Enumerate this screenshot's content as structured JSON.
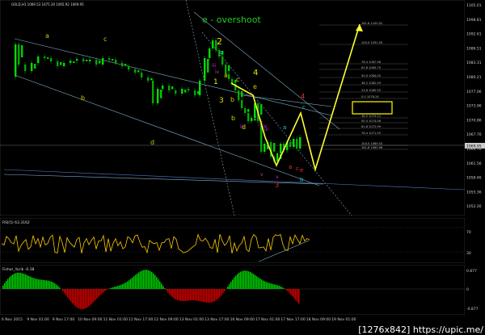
{
  "main": {
    "header": "GOLD,H1  1069.53 1075.30 1065.92 1069.95",
    "overshoot_label": "e - overshoot",
    "wave_labels": [
      {
        "text": "a",
        "color": "#cccc00"
      },
      {
        "text": "b",
        "color": "#cccc00"
      },
      {
        "text": "c",
        "color": "#cccc00"
      },
      {
        "text": "d",
        "color": "#cccc00"
      },
      {
        "text": "2",
        "color": "#e6e600"
      },
      {
        "text": "c",
        "color": "#22ccdd"
      },
      {
        "text": "iii",
        "color": "#cc33cc"
      },
      {
        "text": "iv",
        "color": "#cc33cc"
      },
      {
        "text": "1",
        "color": "#e6e600"
      },
      {
        "text": "a",
        "color": "#cccc00"
      },
      {
        "text": "b",
        "color": "#cccc00"
      },
      {
        "text": "c",
        "color": "#cccc00"
      },
      {
        "text": "4",
        "color": "#e6e600"
      },
      {
        "text": "e",
        "color": "#cccc00"
      },
      {
        "text": "3",
        "color": "#e6e600"
      },
      {
        "text": "b",
        "color": "#cccc00"
      },
      {
        "text": "d",
        "color": "#cccc00"
      },
      {
        "text": "i",
        "color": "#cc33cc"
      },
      {
        "text": "ii",
        "color": "#cc33cc"
      },
      {
        "text": "iv",
        "color": "#cc33cc"
      },
      {
        "text": "v",
        "color": "#cc33cc"
      },
      {
        "text": "iii",
        "color": "#cc33cc"
      },
      {
        "text": "iii",
        "color": "#cc33cc"
      },
      {
        "text": "v",
        "color": "#cc33cc"
      },
      {
        "text": "3",
        "color": "#ee3333"
      },
      {
        "text": "a",
        "color": "#22ccdd"
      },
      {
        "text": "c",
        "color": "#22ccdd"
      },
      {
        "text": "4",
        "color": "#ee3333"
      },
      {
        "text": "a",
        "color": "#ee3333"
      },
      {
        "text": "c",
        "color": "#ee3333"
      },
      {
        "text": "e",
        "color": "#ee3333"
      },
      {
        "text": "b",
        "color": "#22ccdd"
      }
    ],
    "fib_labels": [
      "161.8  1100.02",
      "100.0  1091.95",
      "76.4  1087.96",
      "61.8  1085.70",
      "50.0  1084.05",
      "38.2  1082.59",
      "23.6  1080.55",
      "0.0  1078.24",
      "38.2  1075.12",
      "50.0  1074.06",
      "61.8  1072.99",
      "76.4  1071.55",
      "100.0  1069.53",
      "161.8  1063.98"
    ],
    "current_price": "1069.95"
  },
  "price_scale": {
    "labels": [
      "1105.01",
      "1098.81",
      "1092.61",
      "1086.51",
      "1083.31",
      "1080.21",
      "1077.06",
      "1073.96",
      "1070.86",
      "1067.76",
      "1064.70",
      "1061.56",
      "1058.46",
      "1055.36",
      "1052.26"
    ]
  },
  "rsi": {
    "label": "RSI(5) 63.3162",
    "levels": [
      "70",
      "30"
    ]
  },
  "fisher": {
    "label": "Fisher_Yurik -0.38",
    "levels": [
      "0.877",
      "0",
      "-0.877"
    ]
  },
  "time_axis": {
    "labels": [
      "6 Nov 2015",
      "9 Nov 01:00",
      "9 Nov 17:00",
      "10 Nov 09:00",
      "11 Nov 01:00",
      "11 Nov 17:00",
      "12 Nov 09:00",
      "13 Nov 01:00",
      "13 Nov 17:00",
      "16 Nov 09:00",
      "17 Nov 01:00",
      "17 Nov 17:00",
      "18 Nov 09:00",
      "19 Nov 01:00"
    ]
  },
  "watermark": "[1276x842] https://upic.me/",
  "colors": {
    "bull_candle": "#00dd00",
    "bear_candle": "#00aa00",
    "trendline": "#7fb3cc",
    "wave_path": "#ffff33",
    "rsi_line": "#ffcc00",
    "fisher_pos": "#00cc00",
    "fisher_neg": "#cc0000",
    "highlight_box": "#ffff00"
  }
}
